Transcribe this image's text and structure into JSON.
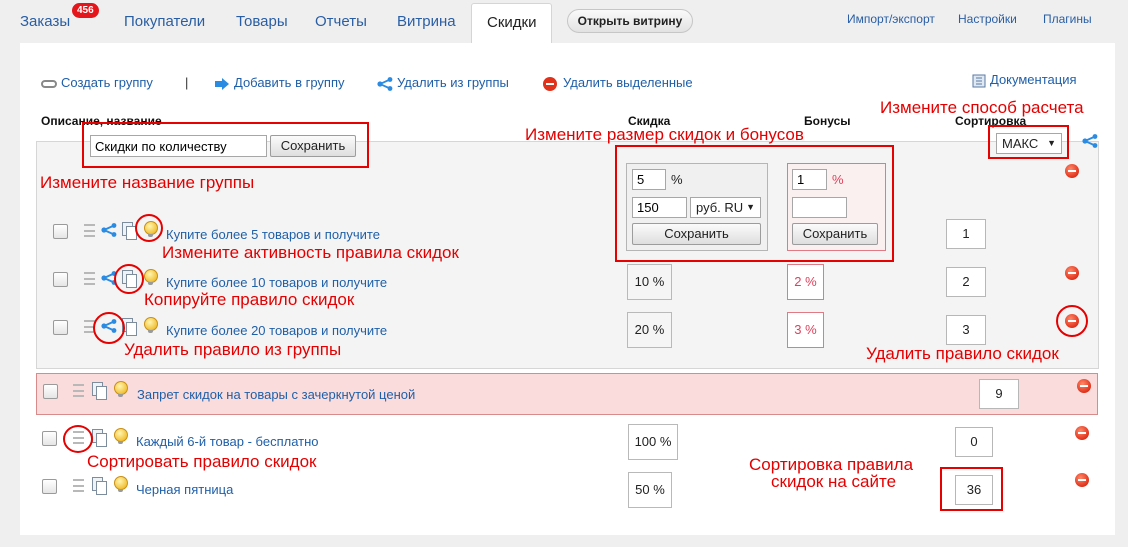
{
  "nav": {
    "tabs": [
      {
        "label": "Заказы",
        "badge": "456"
      },
      {
        "label": "Покупатели"
      },
      {
        "label": "Товары"
      },
      {
        "label": "Отчеты"
      },
      {
        "label": "Витрина"
      },
      {
        "label": "Скидки",
        "active": true
      }
    ],
    "open_storefront": "Открыть витрину",
    "right_links": [
      "Импорт/экспорт",
      "Настройки",
      "Плагины"
    ]
  },
  "toolbar": {
    "create_group": "Создать группу",
    "separator": "|",
    "add_to_group": "Добавить в группу",
    "remove_from_group": "Удалить из группы",
    "delete_selected": "Удалить выделенные",
    "documentation": "Документация"
  },
  "columns": {
    "description": "Описание, название",
    "discount": "Скидка",
    "bonuses": "Бонусы",
    "sorting": "Сортировка"
  },
  "group": {
    "name_value": "Скидки по количеству",
    "save_label": "Сохранить",
    "calc_method": "МАКС",
    "rules": [
      {
        "title": "Купите более 5 товаров и получите",
        "discount_value": "5",
        "discount_unit": "%",
        "discount_amount": "150",
        "currency": "руб. RU",
        "bonus_value": "1",
        "bonus_unit": "%",
        "bonus_amount": "",
        "save_label": "Сохранить",
        "sort": "1"
      },
      {
        "title": "Купите более 10 товаров и получите",
        "discount": "10 %",
        "bonus": "2 %",
        "sort": "2"
      },
      {
        "title": "Купите более 20 товаров и получите",
        "discount": "20 %",
        "bonus": "3 %",
        "sort": "3"
      }
    ]
  },
  "standalone_rules": [
    {
      "title": "Запрет скидок на товары с зачеркнутой ценой",
      "discount": "",
      "sort": "9"
    },
    {
      "title": "Каждый 6-й товар - бесплатно",
      "discount": "100 %",
      "sort": "0"
    },
    {
      "title": "Черная пятница",
      "discount": "50 %",
      "sort": "36"
    }
  ],
  "annotations": {
    "change_calc": "Измените способ расчета",
    "change_size": "Измените размер скидок и бонусов",
    "change_name": "Измените название группы",
    "change_activity": "Измените активность правила скидок",
    "copy_rule": "Копируйте правило скидок",
    "remove_from_group": "Удалить правило из группы",
    "delete_rule": "Удалить правило скидок",
    "sort_rule": "Сортировать правило скидок",
    "sort_site_line1": "Сортировка правила",
    "sort_site_line2": "скидок на сайте"
  },
  "colors": {
    "annotation": "#e60000",
    "link": "#1f5fa8",
    "forbid_row_bg": "#fadcdc"
  }
}
